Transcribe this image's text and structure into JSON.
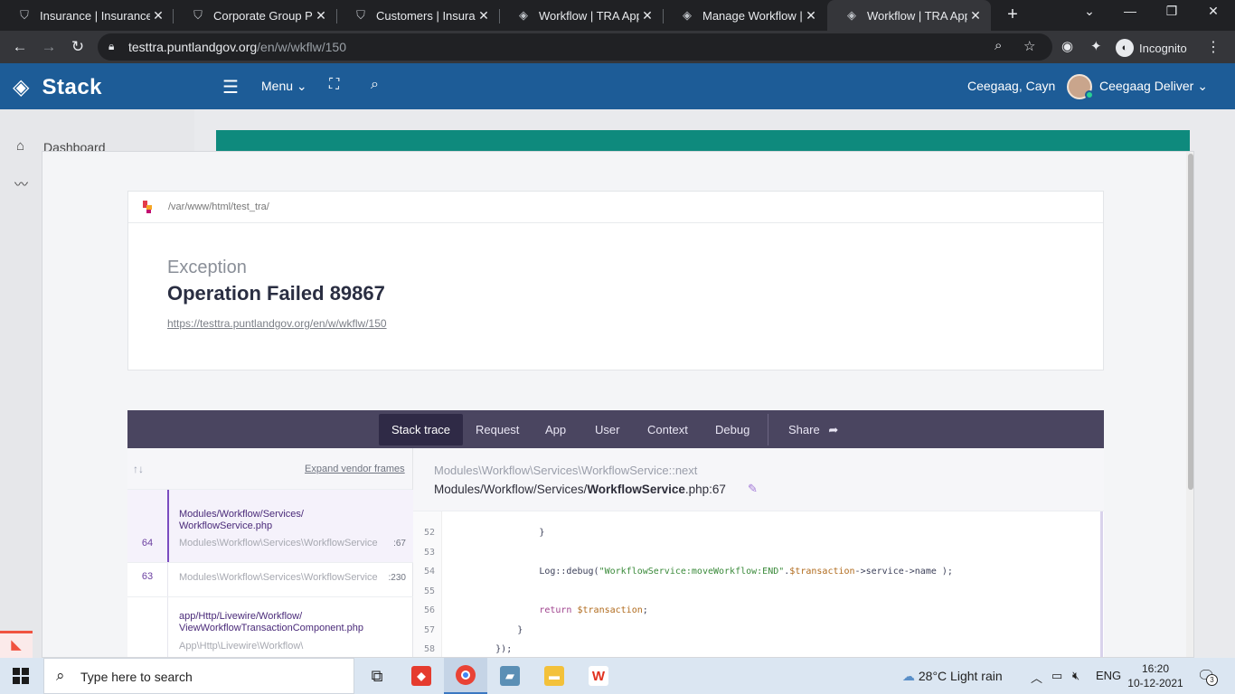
{
  "browser": {
    "tabs": [
      {
        "title": "Insurance | Insurance",
        "active": false
      },
      {
        "title": "Corporate Group Polic",
        "active": false
      },
      {
        "title": "Customers | Insurance",
        "active": false
      },
      {
        "title": "Workflow | TRA App",
        "active": false
      },
      {
        "title": "Manage Workflow | TR",
        "active": false
      },
      {
        "title": "Workflow | TRA App",
        "active": true
      }
    ],
    "close_glyph": "✕",
    "url_host": "testtra.puntlandgov.org",
    "url_path": "/en/w/wkflw/150",
    "mode_label": "Incognito"
  },
  "app": {
    "brand": "Stack",
    "menu_label": "Menu",
    "company": "Ceegaag, Cayn",
    "user": "Ceegaag Deliver",
    "sidebar": {
      "dashboard": "Dashboard"
    },
    "colors": {
      "header": "#1d5c97",
      "banner": "#0e8a7d",
      "trace_bar": "#4a4560"
    }
  },
  "error": {
    "path": "/var/www/html/test_tra/",
    "type": "Exception",
    "message": "Operation Failed 89867",
    "url": "https://testtra.puntlandgov.org/en/w/wkflw/150",
    "tabs": [
      "Stack trace",
      "Request",
      "App",
      "User",
      "Context",
      "Debug",
      "Share"
    ],
    "active_tab": "Stack trace",
    "expand_vendor": "Expand vendor frames",
    "frames": [
      {
        "number": "64",
        "file": "Modules/Workflow/Services/WorkflowService.php",
        "file_line1": "Modules/Workflow/Services/",
        "file_line2": "WorkflowService.php",
        "class": "Modules\\Workflow\\Services\\WorkflowService",
        "line": ":67",
        "selected": true
      },
      {
        "number": "63",
        "class": "Modules\\Workflow\\Services\\WorkflowService",
        "line": ":230",
        "selected": false
      },
      {
        "number": "",
        "file_line1": "app/Http/Livewire/Workflow/",
        "file_line2": "ViewWorkflowTransactionComponent.php",
        "class": "App\\Http\\Livewire\\Workflow\\",
        "selected": false
      }
    ],
    "code": {
      "class_method": "Modules\\Workflow\\Services\\WorkflowService::next",
      "file_dir": "Modules/Workflow/Services/",
      "file_name": "WorkflowService",
      "file_ext": ".php:67",
      "lines": [
        {
          "n": "52",
          "text": "                }"
        },
        {
          "n": "53",
          "text": ""
        },
        {
          "n": "54",
          "prefix": "                Log::debug(",
          "string": "\"WorkflowService:moveWorkflow:END\"",
          "mid": ".",
          "var": "$transaction",
          "suffix": "->service->name );"
        },
        {
          "n": "55",
          "text": ""
        },
        {
          "n": "56",
          "kw": "                return ",
          "var": "$transaction",
          "suffix": ";"
        },
        {
          "n": "57",
          "text": "            }"
        },
        {
          "n": "58",
          "text": "        });"
        }
      ]
    }
  },
  "taskbar": {
    "search_placeholder": "Type here to search",
    "weather": "28°C  Light rain",
    "language": "ENG",
    "time": "16:20",
    "date": "10-12-2021",
    "notifications": "3"
  }
}
